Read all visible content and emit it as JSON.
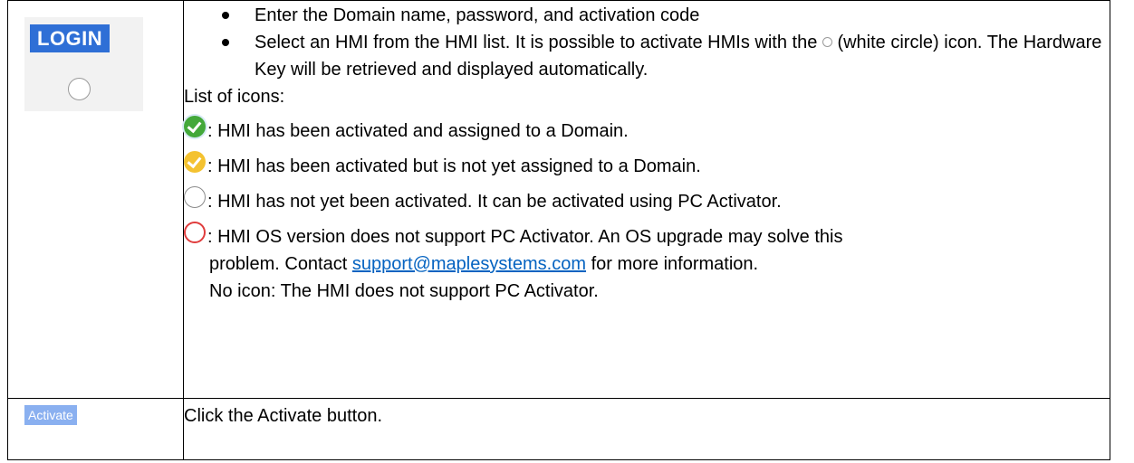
{
  "left_images": {
    "login_label": "LOGIN",
    "activate_label": "Activate"
  },
  "bullets": [
    "Enter the Domain name, password, and activation code",
    {
      "before_icon": "Select an HMI from the HMI list. It is possible to activate HMIs with the",
      "after_icon": "(white circle) icon. The Hardware Key will be retrieved and displayed automatically."
    }
  ],
  "icons_heading": "List of icons:",
  "icon_list": [
    {
      "icon": "green-check-circle-icon",
      "color": "#43a83a",
      "text": ": HMI has been activated and assigned to a Domain."
    },
    {
      "icon": "yellow-check-circle-icon",
      "color": "#f4c230",
      "text": ": HMI has been activated but is not yet assigned to a Domain."
    },
    {
      "icon": "white-circle-icon",
      "color": "#ffffff",
      "text": ": HMI has not yet been activated. It can be activated using PC Activator."
    },
    {
      "icon": "red-circle-icon",
      "color": "#e03c3c",
      "text": ": HMI OS version does not support PC Activator. An OS upgrade may solve this",
      "line2_before": "problem. Contact",
      "link": "support@maplesystems.com",
      "line2_after": "for more information.",
      "line3": "No icon: The HMI does not support PC Activator."
    }
  ],
  "row2_text": "Click the Activate button."
}
